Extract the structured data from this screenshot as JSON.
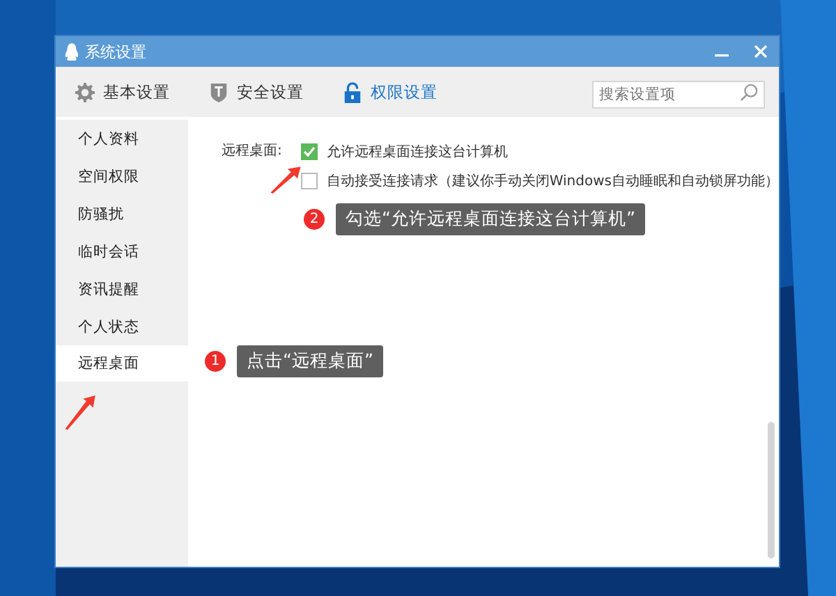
{
  "window": {
    "title": "系统设置"
  },
  "tabs": [
    {
      "label": "基本设置",
      "kind": "gear",
      "selected": false
    },
    {
      "label": "安全设置",
      "kind": "shield",
      "selected": false
    },
    {
      "label": "权限设置",
      "kind": "lock",
      "selected": true
    }
  ],
  "search": {
    "placeholder": "搜索设置项"
  },
  "sidebar": {
    "items": [
      {
        "label": "个人资料",
        "selected": false
      },
      {
        "label": "空间权限",
        "selected": false
      },
      {
        "label": "防骚扰",
        "selected": false
      },
      {
        "label": "临时会话",
        "selected": false
      },
      {
        "label": "资讯提醒",
        "selected": false
      },
      {
        "label": "个人状态",
        "selected": false
      },
      {
        "label": "远程桌面",
        "selected": true
      }
    ]
  },
  "section": {
    "label": "远程桌面:",
    "options": [
      {
        "label": "允许远程桌面连接这台计算机",
        "checked": true
      },
      {
        "label": "自动接受连接请求（建议你手动关闭Windows自动睡眠和自动锁屏功能）",
        "checked": false
      }
    ]
  },
  "annotations": [
    {
      "number": "1",
      "text": "点击“远程桌面”"
    },
    {
      "number": "2",
      "text": "勾选“允许远程桌面连接这台计算机”"
    }
  ]
}
